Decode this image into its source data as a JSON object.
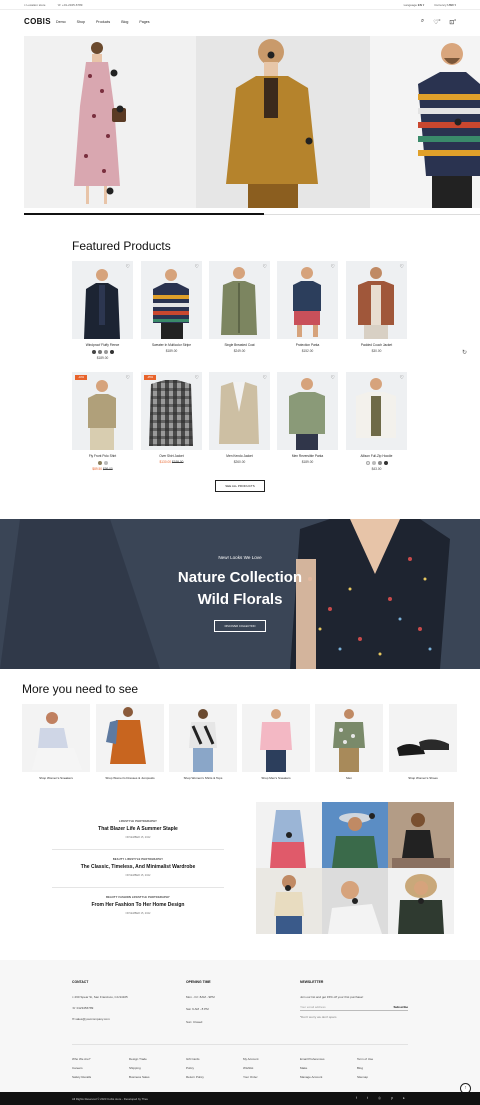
{
  "topbar": {
    "location": "Location store",
    "phone": "+01-2345-6789",
    "language_label": "Language",
    "language": "EN",
    "currency_label": "Currency",
    "currency": "USD"
  },
  "header": {
    "logo": "COBIS",
    "nav": [
      "Demo",
      "Shop",
      "Products",
      "Blog",
      "Pages"
    ],
    "wishlist_count": "0",
    "cart_count": "0"
  },
  "featured": {
    "title": "Featured Products",
    "products": [
      {
        "name": "Windproof Fluffy Fleece",
        "price": "$189.00"
      },
      {
        "name": "Sweater In Multicolor Stripe",
        "price": "$189.00"
      },
      {
        "name": "Single Breasted Coat",
        "price": "$249.00"
      },
      {
        "name": "Protection Parka",
        "price": "$152.00"
      },
      {
        "name": "Padded Couch Jacket",
        "price": "$30.00"
      },
      {
        "name": "Fly Front Polo Shirt",
        "price": "$89.50",
        "old_price": "$99.00",
        "badge": "-10%"
      },
      {
        "name": "Over Shirt Jacket",
        "price": "$130.00",
        "old_price": "$199.00",
        "badge": "-35%"
      },
      {
        "name": "Men Kendo Jacket",
        "price": "$260.00"
      },
      {
        "name": "Men Reversible Parka",
        "price": "$189.00"
      },
      {
        "name": "Allison Full-Zip Hoodie",
        "price": "$43.00"
      }
    ],
    "button": "SEE ALL PRODUCTS"
  },
  "banner": {
    "kicker": "New! Looks We Love",
    "title1": "Nature Collection",
    "title2": "Wild Florals",
    "button": "DISCOVER COLLECTION"
  },
  "more": {
    "title": "More you need to see",
    "items": [
      "Shop Women's Sneakers",
      "Shop Women's Dresses & Jumpsuits",
      "Shop Women's Shirts & Tops",
      "Shop Men's Sneakers",
      "Men",
      "Shop Women's Shoes"
    ]
  },
  "blog": [
    {
      "tags": "LIFESTYLE  PHOTOGRAPHY",
      "title": "That Blazer Life A Summer Staple",
      "date": "NOVEMBER 15, 2022"
    },
    {
      "tags": "BEAUTY  LIFESTYLE  PHOTOGRAPHY",
      "title": "The Classic, Timeless, And Minimalist Wardrobe",
      "date": "NOVEMBER 15, 2022"
    },
    {
      "tags": "BEAUTY  FASHION  LIFESTYLE  PHOTOGRAPHY",
      "title": "From Her Fashion To Her Home Design",
      "date": "NOVEMBER 15, 2022"
    }
  ],
  "footer": {
    "contact_title": "CONTACT",
    "address": "260 Spear St, San Francisco, CA 94105",
    "phone": "0123456789",
    "email": "sales@yourcompany.com",
    "hours_title": "OPENING TIME",
    "hours": [
      "Mon - Fri: 8AM - 9PM",
      "Sat: 9 AM - 8 PM",
      "Sun: Closed"
    ],
    "newsletter_title": "NEWSLETTER",
    "newsletter_text": "Join our list and get 15% off your first purchase!",
    "email_placeholder": "Your email address",
    "subscribe": "Subscribe",
    "spam_note": "*Don't worry we don't spam",
    "links": [
      [
        "Who We Are?",
        "Careers",
        "Safety Recalls"
      ],
      [
        "Design Trade",
        "Shipping",
        "Business Sales"
      ],
      [
        "Gift Cards",
        "Policy",
        "Return Policy"
      ],
      [
        "My Account",
        "Wishlist",
        "Your Order"
      ],
      [
        "Email Preferences",
        "Make",
        "Manage Account"
      ],
      [
        "Term of Use",
        "Blog",
        "Sitemap"
      ]
    ],
    "copyright": "All Rights Reserved © 2023 Cobis store - Developed by Theu"
  },
  "colors": {
    "accent": "#e8632b",
    "banner_bg": "#3a4556",
    "dark": "#111111"
  }
}
